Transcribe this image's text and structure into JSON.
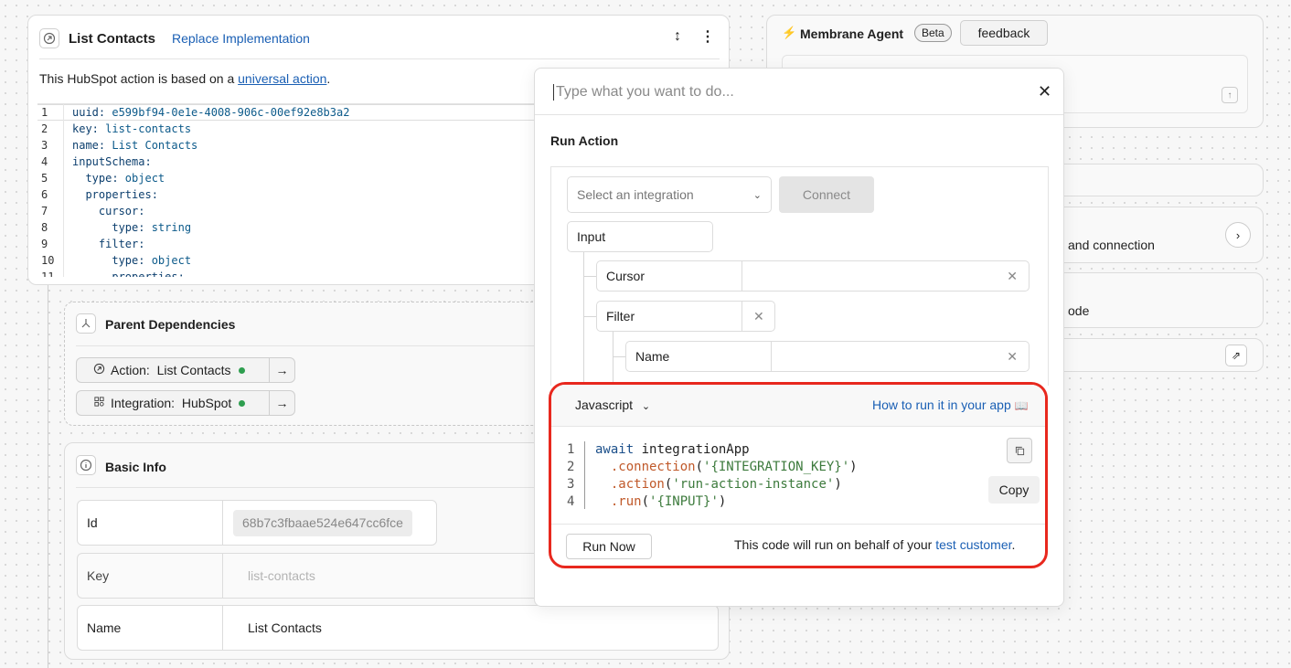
{
  "left_card": {
    "title": "List Contacts",
    "replace_link": "Replace Implementation",
    "description_prefix": "This HubSpot action is based on a ",
    "description_link": "universal action",
    "description_suffix": ".",
    "code_lines": [
      {
        "n": "1",
        "k": "uuid",
        "v": " e599bf94-0e1e-4008-906c-00ef92e8b3a2",
        "indent": ""
      },
      {
        "n": "2",
        "k": "key",
        "v": " list-contacts",
        "indent": ""
      },
      {
        "n": "3",
        "k": "name",
        "v": " List Contacts",
        "indent": ""
      },
      {
        "n": "4",
        "k": "inputSchema",
        "v": "",
        "indent": ""
      },
      {
        "n": "5",
        "k": "type",
        "v": " object",
        "indent": "  "
      },
      {
        "n": "6",
        "k": "properties",
        "v": "",
        "indent": "  "
      },
      {
        "n": "7",
        "k": "cursor",
        "v": "",
        "indent": "    "
      },
      {
        "n": "8",
        "k": "type",
        "v": " string",
        "indent": "      "
      },
      {
        "n": "9",
        "k": "filter",
        "v": "",
        "indent": "    "
      },
      {
        "n": "10",
        "k": "type",
        "v": " object",
        "indent": "      "
      },
      {
        "n": "11",
        "k": "properties",
        "v": "",
        "indent": "      "
      }
    ]
  },
  "parent_deps": {
    "title": "Parent Dependencies",
    "action_label": "Action:",
    "action_value": "List Contacts",
    "integration_label": "Integration:",
    "integration_value": "HubSpot"
  },
  "basic_info": {
    "title": "Basic Info",
    "id_label": "Id",
    "id_value": "68b7c3fbaae524e647cc6fce",
    "key_label": "Key",
    "key_placeholder": "list-contacts",
    "name_label": "Name",
    "name_value": "List Contacts"
  },
  "agent": {
    "title": "Membrane Agent",
    "beta": "Beta",
    "feedback": "feedback",
    "partial_1": "and connection",
    "partial_2": "ode"
  },
  "modal": {
    "search_placeholder": "Type what you want to do...",
    "run_action_title": "Run Action",
    "integration_placeholder": "Select an integration",
    "connect_button": "Connect",
    "input_label": "Input",
    "cursor_label": "Cursor",
    "filter_label": "Filter",
    "name_label": "Name",
    "language": "Javascript",
    "how_to_link": "How to run it in your app",
    "snippet": [
      {
        "n": "1",
        "parts": [
          [
            "kw",
            "await"
          ],
          [
            "",
            " integrationApp"
          ]
        ]
      },
      {
        "n": "2",
        "parts": [
          [
            "",
            "  "
          ],
          [
            "fn",
            ".connection"
          ],
          [
            "",
            "("
          ],
          [
            "str",
            "'{INTEGRATION_KEY}'"
          ],
          [
            "",
            ")"
          ]
        ]
      },
      {
        "n": "3",
        "parts": [
          [
            "",
            "  "
          ],
          [
            "fn",
            ".action"
          ],
          [
            "",
            "("
          ],
          [
            "str",
            "'run-action-instance'"
          ],
          [
            "",
            ")"
          ]
        ]
      },
      {
        "n": "4",
        "parts": [
          [
            "",
            "  "
          ],
          [
            "fn",
            ".run"
          ],
          [
            "",
            "("
          ],
          [
            "str",
            "'{INPUT}'"
          ],
          [
            "",
            ")"
          ]
        ]
      }
    ],
    "copy_tooltip": "Copy",
    "run_now_button": "Run Now",
    "footer_text": "This code will run on behalf of your ",
    "footer_link": "test customer",
    "footer_suffix": "."
  }
}
